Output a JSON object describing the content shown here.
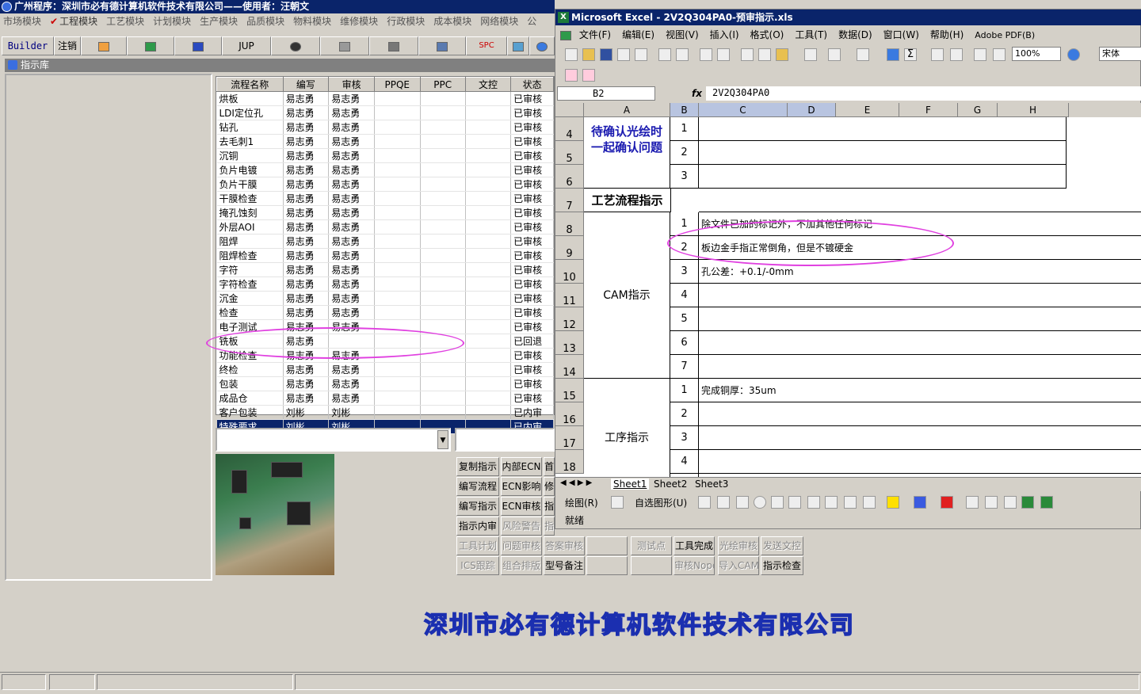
{
  "app": {
    "title": "广州程序：深圳市必有德计算机软件技术有限公司——使用者：汪朝文",
    "menu": [
      "市场模块",
      "工程模块",
      "工艺模块",
      "计划模块",
      "生产模块",
      "品质模块",
      "物料模块",
      "维修模块",
      "行政模块",
      "成本模块",
      "网络模块",
      "公"
    ],
    "toolbar": {
      "builder": "Builder",
      "logout": "注销",
      "jup": "JUP",
      "spc": "SPC"
    },
    "library_title": "指示库",
    "table": {
      "headers": [
        "流程名称",
        "编写",
        "审核",
        "PPQE",
        "PPC",
        "文控",
        "状态"
      ],
      "rows": [
        [
          "烘板",
          "易志勇",
          "易志勇",
          "",
          "",
          "",
          "已审核"
        ],
        [
          "LDI定位孔",
          "易志勇",
          "易志勇",
          "",
          "",
          "",
          "已审核"
        ],
        [
          "钻孔",
          "易志勇",
          "易志勇",
          "",
          "",
          "",
          "已审核"
        ],
        [
          "去毛刺1",
          "易志勇",
          "易志勇",
          "",
          "",
          "",
          "已审核"
        ],
        [
          "沉铜",
          "易志勇",
          "易志勇",
          "",
          "",
          "",
          "已审核"
        ],
        [
          "负片电镀",
          "易志勇",
          "易志勇",
          "",
          "",
          "",
          "已审核"
        ],
        [
          "负片干膜",
          "易志勇",
          "易志勇",
          "",
          "",
          "",
          "已审核"
        ],
        [
          "干膜检查",
          "易志勇",
          "易志勇",
          "",
          "",
          "",
          "已审核"
        ],
        [
          "掩孔蚀刻",
          "易志勇",
          "易志勇",
          "",
          "",
          "",
          "已审核"
        ],
        [
          "外层AOI",
          "易志勇",
          "易志勇",
          "",
          "",
          "",
          "已审核"
        ],
        [
          "阻焊",
          "易志勇",
          "易志勇",
          "",
          "",
          "",
          "已审核"
        ],
        [
          "阻焊检查",
          "易志勇",
          "易志勇",
          "",
          "",
          "",
          "已审核"
        ],
        [
          "字符",
          "易志勇",
          "易志勇",
          "",
          "",
          "",
          "已审核"
        ],
        [
          "字符检查",
          "易志勇",
          "易志勇",
          "",
          "",
          "",
          "已审核"
        ],
        [
          "沉金",
          "易志勇",
          "易志勇",
          "",
          "",
          "",
          "已审核"
        ],
        [
          "检查",
          "易志勇",
          "易志勇",
          "",
          "",
          "",
          "已审核"
        ],
        [
          "电子测试",
          "易志勇",
          "易志勇",
          "",
          "",
          "",
          "已审核"
        ],
        [
          "铣板",
          "易志勇",
          "",
          "",
          "",
          "",
          "已回退"
        ],
        [
          "功能检查",
          "易志勇",
          "易志勇",
          "",
          "",
          "",
          "已审核"
        ],
        [
          "终检",
          "易志勇",
          "易志勇",
          "",
          "",
          "",
          "已审核"
        ],
        [
          "包装",
          "易志勇",
          "易志勇",
          "",
          "",
          "",
          "已审核"
        ],
        [
          "成品仓",
          "易志勇",
          "易志勇",
          "",
          "",
          "",
          "已审核"
        ],
        [
          "客户包装",
          "刘彬",
          "刘彬",
          "",
          "",
          "",
          "已内审"
        ],
        [
          "特殊要求",
          "刘彬",
          "刘彬",
          "",
          "",
          "",
          "已内审"
        ]
      ]
    },
    "buttons": {
      "row1": [
        "复制指示",
        "内部ECN",
        "首"
      ],
      "row2": [
        "编写流程",
        "ECN影响",
        "修"
      ],
      "row3": [
        "编写指示",
        "ECN审核",
        "指"
      ],
      "row4": [
        "指示内审",
        "风险警告",
        "指示"
      ],
      "row5": [
        "工具计划",
        "问题审核",
        "答案审核",
        "",
        "测试点",
        "工具完成",
        "光绘审核",
        "发送文控"
      ],
      "row6": [
        "ICS跟踪",
        "组合排版",
        "型号备注",
        "",
        "",
        "审核Nope",
        "导入CAM",
        "指示检查"
      ]
    },
    "company_banner": "深圳市必有德计算机软件技术有限公司"
  },
  "excel": {
    "title": "Microsoft Excel - 2V2Q304PA0-预审指示.xls",
    "menu": [
      "文件(F)",
      "编辑(E)",
      "视图(V)",
      "插入(I)",
      "格式(O)",
      "工具(T)",
      "数据(D)",
      "窗口(W)",
      "帮助(H)",
      "Adobe PDF(B)"
    ],
    "zoom": "100%",
    "font": "宋体",
    "namebox": "B2",
    "fx": "fx",
    "formula": "2V2Q304PA0",
    "columns": [
      "A",
      "B",
      "C",
      "D",
      "E",
      "F",
      "G",
      "H"
    ],
    "rows": [
      "4",
      "5",
      "6",
      "7",
      "8",
      "9",
      "10",
      "11",
      "12",
      "13",
      "14",
      "15",
      "16",
      "17",
      "18"
    ],
    "cells": {
      "confirm_label": "待确认光绘时一起确认问题",
      "process_title": "工艺流程指示",
      "cam_label": "CAM指示",
      "proc_label": "工序指示",
      "n1": "1",
      "n2": "2",
      "n3": "3",
      "n4": "4",
      "n5": "5",
      "n6": "6",
      "n7": "7",
      "cam1": "除文件已加的标记外，不加其他任何标记",
      "cam2": "板边金手指正常倒角，但是不镀硬金",
      "cam3": "孔公差：+0.1/-0mm",
      "proc1": "完成铜厚：35um"
    },
    "tabs": [
      "Sheet1",
      "Sheet2",
      "Sheet3"
    ],
    "draw_label": "绘图(R)",
    "autoshape": "自选图形(U)",
    "status": "就绪"
  },
  "colors": {
    "titlebar": "#0a246a",
    "face": "#d4d0c8",
    "highlight": "#e040e0",
    "heading_blue": "#1a1ab0"
  }
}
